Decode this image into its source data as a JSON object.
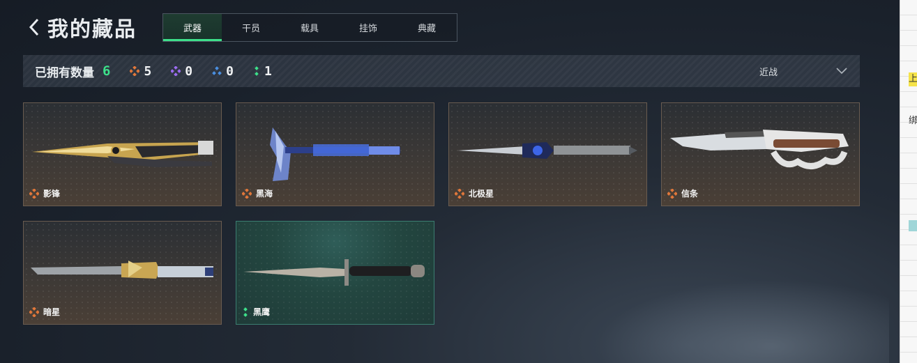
{
  "header": {
    "title": "我的藏品"
  },
  "tabs": [
    {
      "label": "武器",
      "active": true
    },
    {
      "label": "干员",
      "active": false
    },
    {
      "label": "载具",
      "active": false
    },
    {
      "label": "挂饰",
      "active": false
    },
    {
      "label": "典藏",
      "active": false
    }
  ],
  "stats": {
    "owned_label": "已拥有数量",
    "owned_count": "6",
    "rarities": [
      {
        "icon": "orange-diamond-icon",
        "color": "#e0773a",
        "count": "5"
      },
      {
        "icon": "purple-diamond-icon",
        "color": "#9b6cf0",
        "count": "0"
      },
      {
        "icon": "blue-diamond-icon",
        "color": "#4a8fe0",
        "count": "0"
      },
      {
        "icon": "green-diamond-icon",
        "color": "#3de08a",
        "count": "1"
      }
    ]
  },
  "filter": {
    "label": "近战"
  },
  "items": [
    {
      "name": "影锋",
      "rarity_color": "#e0773a"
    },
    {
      "name": "黑海",
      "rarity_color": "#e0773a"
    },
    {
      "name": "北极星",
      "rarity_color": "#e0773a"
    },
    {
      "name": "信条",
      "rarity_color": "#e0773a"
    },
    {
      "name": "暗星",
      "rarity_color": "#e0773a"
    },
    {
      "name": "黑鹰",
      "rarity_color": "#3de08a"
    }
  ],
  "side_panel": {
    "marks": [
      "上",
      "绑"
    ]
  }
}
